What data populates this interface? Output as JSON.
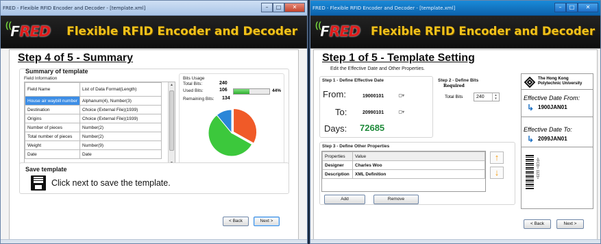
{
  "window1": {
    "title": "FRED - Flexible RFID Encoder and Decoder - [template.xml]",
    "logo_prefix": "F",
    "logo_red": "RED",
    "banner_title": "Flexible RFID Encoder and Decoder",
    "step_title": "Step 4 of 5 - Summary",
    "summary_label": "Summary of template",
    "field_info_label": "Field Information",
    "table": {
      "headers": [
        "Field Name",
        "List of Data Format(Length)"
      ],
      "rows": [
        [
          "House air waybill number",
          "Alphanum(4), Number(3)"
        ],
        [
          "Destination",
          "Choice (External File)(1939)"
        ],
        [
          "Origins",
          "Choice (External File)(1939)"
        ],
        [
          "Number of pieces",
          "Number(2)"
        ],
        [
          "Total number of pieces",
          "Number(2)"
        ],
        [
          "Weight",
          "Number(9)"
        ],
        [
          "Date",
          "Date"
        ]
      ]
    },
    "bits": {
      "group_label": "Bits Usage",
      "total_label": "Total Bits:",
      "total_value": "240",
      "used_label": "Used Bits:",
      "used_value": "106",
      "percent": "44%",
      "used_fraction": 0.44,
      "remaining_label": "Remaining Bits:",
      "remaining_value": "134"
    },
    "save": {
      "label": "Save template",
      "message": "Click next to save the template."
    },
    "back_label": "< Back",
    "next_label": "Next >"
  },
  "window2": {
    "title": "FRED - Flexible RFID Encoder and Decoder - [template.xml]",
    "logo_prefix": "F",
    "logo_red": "RED",
    "banner_title": "Flexible RFID Encoder and Decoder",
    "step_title": "Step 1 of 5 - Template Setting",
    "subtitle": "Edit the Effective Date and Other Properties.",
    "step1": {
      "label": "Step 1 - Define Effective Date",
      "from_label": "From:",
      "from_value": "19000101",
      "to_label": "To:",
      "to_value": "20990101",
      "days_label": "Days:",
      "days_value": "72685"
    },
    "step2": {
      "label": "Step 2 - Define Bits",
      "required": "Required",
      "total_label": "Total Bits",
      "total_value": "240"
    },
    "step3": {
      "label": "Step 3 - Define Other Properties",
      "headers": [
        "Properties",
        "Value"
      ],
      "rows": [
        [
          "Designer",
          "Charles Woo"
        ],
        [
          "Description",
          "XML Definition"
        ]
      ],
      "add_label": "Add",
      "remove_label": "Remove"
    },
    "label_preview": {
      "org_line1": "The Hong Kong",
      "org_line2": "Polytechnic University",
      "from_label": "Effective Date From:",
      "from_value": "1900JAN01",
      "to_label": "Effective Date To:",
      "to_value": "2099JAN01",
      "barcode_text": "<FCD> 1123>"
    },
    "back_label": "< Back",
    "next_label": "Next >"
  },
  "colors": {
    "accent_yellow": "#f1c21a",
    "logo_red": "#e01b1b",
    "pie_orange": "#f05a28",
    "pie_green": "#3cc83c",
    "pie_blue": "#2a86d8",
    "days_green": "#1e8a3a",
    "arrow_orange": "#f39c12",
    "link_blue": "#1f72c4"
  },
  "icons": [
    "wave-icon",
    "floppy-disk-icon",
    "arrow-up-icon",
    "arrow-down-icon",
    "calendar-dropdown-icon",
    "spinner-icon",
    "polyu-logo-icon",
    "blue-arrow-icon",
    "barcode-icon",
    "minimize-icon",
    "maximize-icon",
    "close-icon"
  ]
}
